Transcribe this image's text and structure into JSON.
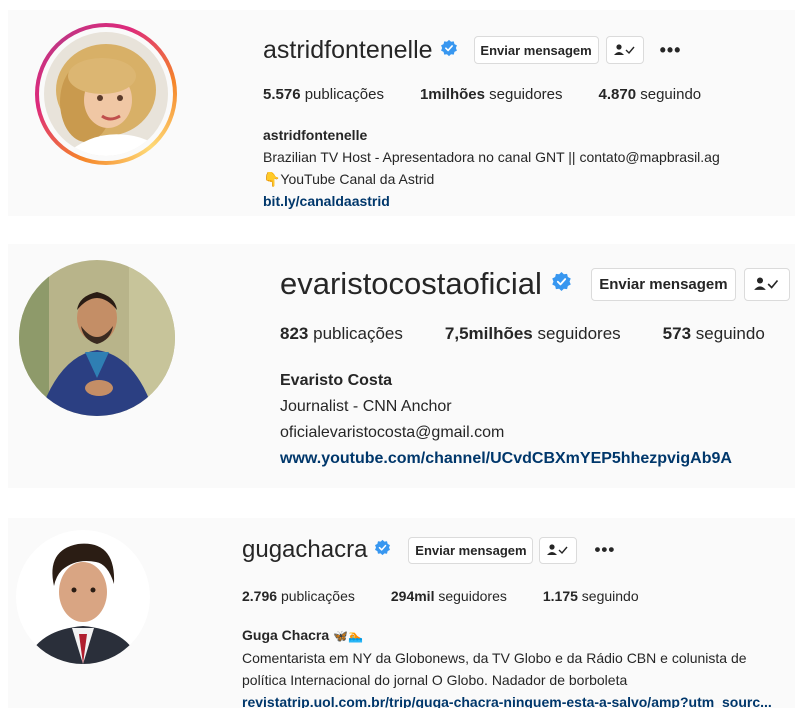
{
  "profiles": [
    {
      "username": "astridfontenelle",
      "message_button": "Enviar mensagem",
      "stats": {
        "posts_value": "5.576",
        "posts_label": "publicações",
        "followers_value": "1milhões",
        "followers_label": "seguidores",
        "following_value": "4.870",
        "following_label": "seguindo"
      },
      "bio": {
        "name": "astridfontenelle",
        "line1": "Brazilian TV Host - Apresentadora no canal GNT || contato@mapbrasil.ag",
        "line2": "👇YouTube Canal da Astrid",
        "link": "bit.ly/canaldaastrid"
      }
    },
    {
      "username": "evaristocostaoficial",
      "message_button": "Enviar mensagem",
      "stats": {
        "posts_value": "823",
        "posts_label": "publicações",
        "followers_value": "7,5milhões",
        "followers_label": "seguidores",
        "following_value": "573",
        "following_label": "seguindo"
      },
      "bio": {
        "name": "Evaristo Costa",
        "line1": "Journalist - CNN Anchor",
        "line2": "oficialevaristocosta@gmail.com",
        "link": "www.youtube.com/channel/UCvdCBXmYEP5hhezpvigAb9A"
      }
    },
    {
      "username": "gugachacra",
      "message_button": "Enviar mensagem",
      "stats": {
        "posts_value": "2.796",
        "posts_label": "publicações",
        "followers_value": "294mil",
        "followers_label": "seguidores",
        "following_value": "1.175",
        "following_label": "seguindo"
      },
      "bio": {
        "name": "Guga Chacra",
        "name_emoji": "🦋🏊",
        "line1": "Comentarista em NY da Globonews, da TV Globo e da Rádio CBN e colunista de",
        "line2": "política Internacional do jornal O Globo. Nadador de borboleta",
        "link": "revistatrip.uol.com.br/trip/guga-chacra-ninguem-esta-a-salvo/amp?utm_sourc..."
      }
    }
  ],
  "colors": {
    "verified": "#3897f0",
    "link": "#00376b",
    "card_bg": "#fafafa"
  },
  "icons": [
    "verified-badge-icon",
    "follow-check-icon",
    "more-options-icon"
  ]
}
